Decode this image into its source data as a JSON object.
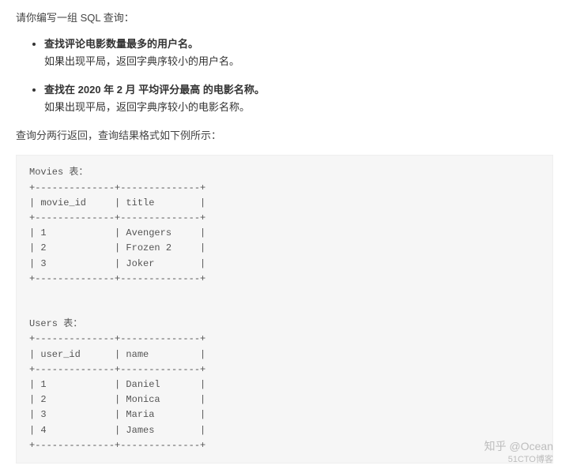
{
  "intro": "请你编写一组 SQL 查询：",
  "tasks": [
    {
      "main_bold": "查找评论电影数量最多的用户名。",
      "sub": "如果出现平局，返回字典序较小的用户名。"
    },
    {
      "main_prefix": "查找在 ",
      "main_bold_date": "2020 年 2 月",
      "main_mid": " ",
      "main_bold_metric": "平均评分最高",
      "main_suffix": " 的电影名称。",
      "sub": "如果出现平局，返回字典序较小的电影名称。"
    }
  ],
  "outro": "查询分两行返回，查询结果格式如下例所示：",
  "tables": {
    "movies": {
      "title": "Movies 表：",
      "columns": [
        "movie_id",
        "title"
      ],
      "rows": [
        [
          "1",
          "Avengers"
        ],
        [
          "2",
          "Frozen 2"
        ],
        [
          "3",
          "Joker"
        ]
      ]
    },
    "users": {
      "title": "Users 表：",
      "columns": [
        "user_id",
        "name"
      ],
      "rows": [
        [
          "1",
          "Daniel"
        ],
        [
          "2",
          "Monica"
        ],
        [
          "3",
          "Maria"
        ],
        [
          "4",
          "James"
        ]
      ]
    }
  },
  "watermark": {
    "line1": "知乎 @Ocean",
    "line2": "51CTO博客"
  }
}
